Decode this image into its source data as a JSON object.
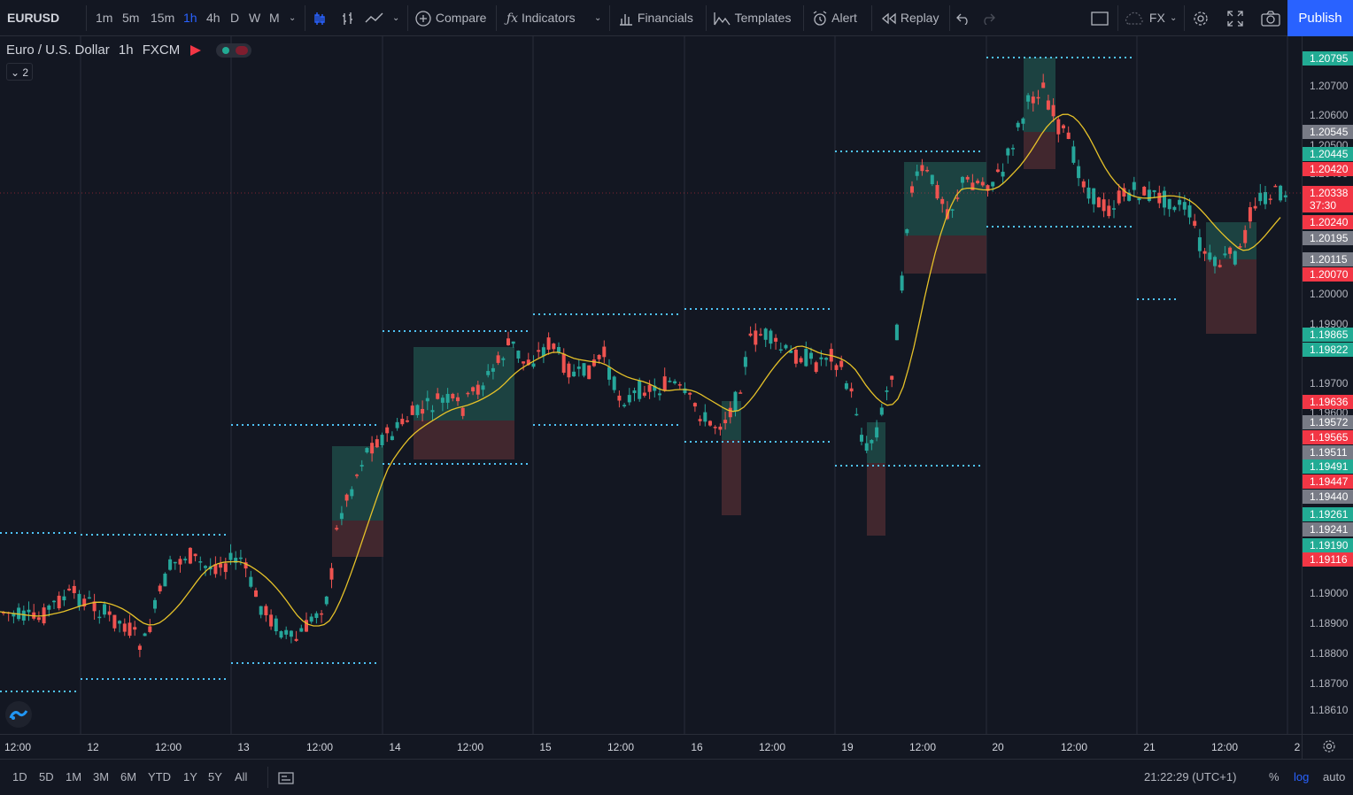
{
  "toolbar": {
    "symbol": "EURUSD",
    "intervals": [
      "1m",
      "5m",
      "15m",
      "1h",
      "4h",
      "D",
      "W",
      "M"
    ],
    "active_interval": "1h",
    "compare_label": "Compare",
    "indicators_label": "Indicators",
    "financials_label": "Financials",
    "templates_label": "Templates",
    "alert_label": "Alert",
    "replay_label": "Replay",
    "currency_label": "FX",
    "publish_label": "Publish"
  },
  "legend": {
    "name": "Euro / U.S. Dollar",
    "interval": "1h",
    "exchange": "FXCM",
    "collapse_count": "2"
  },
  "price_axis": {
    "ticks": [
      "1.20700",
      "1.20600",
      "1.20500",
      "1.20400",
      "1.20000",
      "1.19900",
      "1.19700",
      "1.19600",
      "1.19000",
      "1.18900",
      "1.18800",
      "1.18700",
      "1.18610"
    ],
    "labels": [
      {
        "text": "1.20795",
        "color": "#22ab94"
      },
      {
        "text": "1.20545",
        "color": "#787b86"
      },
      {
        "text": "1.20445",
        "color": "#22ab94"
      },
      {
        "text": "1.20420",
        "color": "#f23645"
      },
      {
        "text": "1.20338",
        "color": "#f23645"
      },
      {
        "text": "37:30",
        "color": "#f23645"
      },
      {
        "text": "1.20240",
        "color": "#f23645"
      },
      {
        "text": "1.20195",
        "color": "#787b86"
      },
      {
        "text": "1.20115",
        "color": "#787b86"
      },
      {
        "text": "1.20070",
        "color": "#f23645"
      },
      {
        "text": "1.19865",
        "color": "#22ab94"
      },
      {
        "text": "1.19822",
        "color": "#22ab94"
      },
      {
        "text": "1.19636",
        "color": "#f23645"
      },
      {
        "text": "1.19572",
        "color": "#787b86"
      },
      {
        "text": "1.19565",
        "color": "#f23645"
      },
      {
        "text": "1.19511",
        "color": "#787b86"
      },
      {
        "text": "1.19491",
        "color": "#22ab94"
      },
      {
        "text": "1.19447",
        "color": "#f23645"
      },
      {
        "text": "1.19440",
        "color": "#787b86"
      },
      {
        "text": "1.19261",
        "color": "#22ab94"
      },
      {
        "text": "1.19241",
        "color": "#787b86"
      },
      {
        "text": "1.19190",
        "color": "#22ab94"
      },
      {
        "text": "1.19116",
        "color": "#f23645"
      }
    ]
  },
  "time_axis": {
    "labels": [
      "12:00",
      "12",
      "12:00",
      "13",
      "12:00",
      "14",
      "12:00",
      "15",
      "12:00",
      "16",
      "12:00",
      "19",
      "12:00",
      "20",
      "12:00",
      "21",
      "12:00",
      "2"
    ]
  },
  "bottom_bar": {
    "ranges": [
      "1D",
      "5D",
      "1M",
      "3M",
      "6M",
      "YTD",
      "1Y",
      "5Y",
      "All"
    ],
    "clock": "21:22:29 (UTC+1)",
    "percent_label": "%",
    "log_label": "log",
    "auto_label": "auto"
  },
  "colors": {
    "up": "#26a69a",
    "down": "#ef5350",
    "ma": "#e6c229",
    "level": "#4fc3f7",
    "background": "#131722",
    "accent": "#2962ff"
  }
}
